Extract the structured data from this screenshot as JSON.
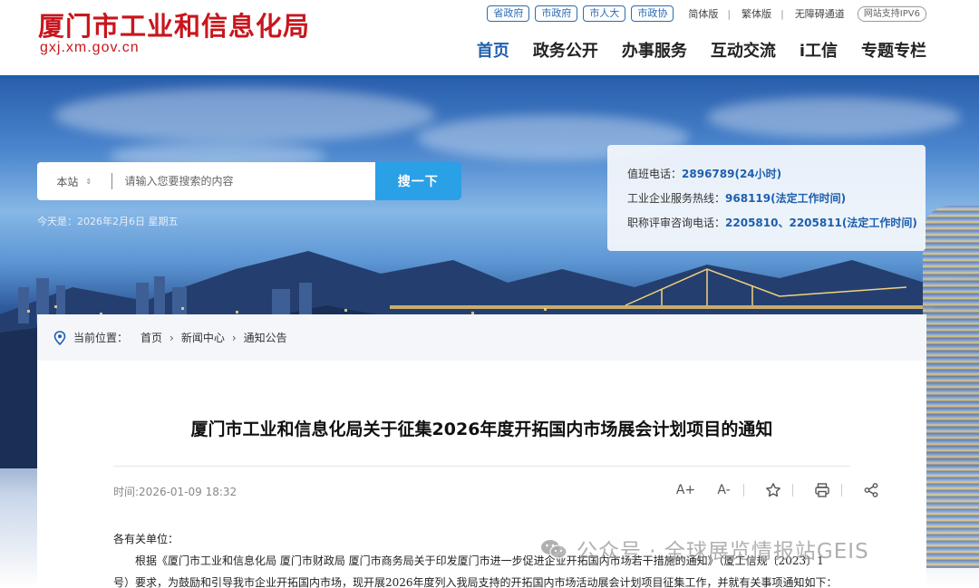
{
  "header": {
    "site_title": "厦门市工业和信息化局",
    "domain": "gxj.xm.gov.cn",
    "quick_links": [
      "省政府",
      "市政府",
      "市人大",
      "市政协"
    ],
    "simplified": "简体版",
    "traditional": "繁体版",
    "accessible": "无障碍通道",
    "ipv6": "网站支持IPV6",
    "nav": [
      "首页",
      "政务公开",
      "办事服务",
      "互动交流",
      "i工信",
      "专题专栏"
    ],
    "active_nav": "首页"
  },
  "search": {
    "scope": "本站",
    "placeholder": "请输入您要搜索的内容",
    "button": "搜一下"
  },
  "today": "今天是：2026年2月6日 星期五",
  "hotline": {
    "rows": [
      {
        "label": "值班电话：",
        "value": "2896789(24小时)"
      },
      {
        "label": "工业企业服务热线：",
        "value": "968119(法定工作时间)"
      },
      {
        "label": "职称评审咨询电话：",
        "value": "2205810、2205811(法定工作时间)"
      }
    ]
  },
  "breadcrumb": {
    "label": "当前位置：",
    "items": [
      "首页",
      "新闻中心",
      "通知公告"
    ]
  },
  "article": {
    "title": "厦门市工业和信息化局关于征集2026年度开拓国内市场展会计划项目的通知",
    "time": "时间:2026-01-09 18:32",
    "salutation": "各有关单位：",
    "paragraph_1": "根据《厦门市工业和信息化局 厦门市财政局 厦门市商务局关于印发厦门市进一步促进企业开拓国内市场若干措施的通知》（厦工信规〔2023〕1",
    "paragraph_2": "号）要求，为鼓励和引导我市企业开拓国内市场，现开展2026年度列入我局支持的开拓国内市场活动展会计划项目征集工作，并就有关事项通知如下："
  },
  "tools": [
    "A+",
    "A-"
  ],
  "watermark": "公众号 · 全球展览情报站GEIS",
  "colors": {
    "brand_red": "#c8161d",
    "brand_blue": "#1d5fae",
    "search_button": "#2aa0e6"
  }
}
